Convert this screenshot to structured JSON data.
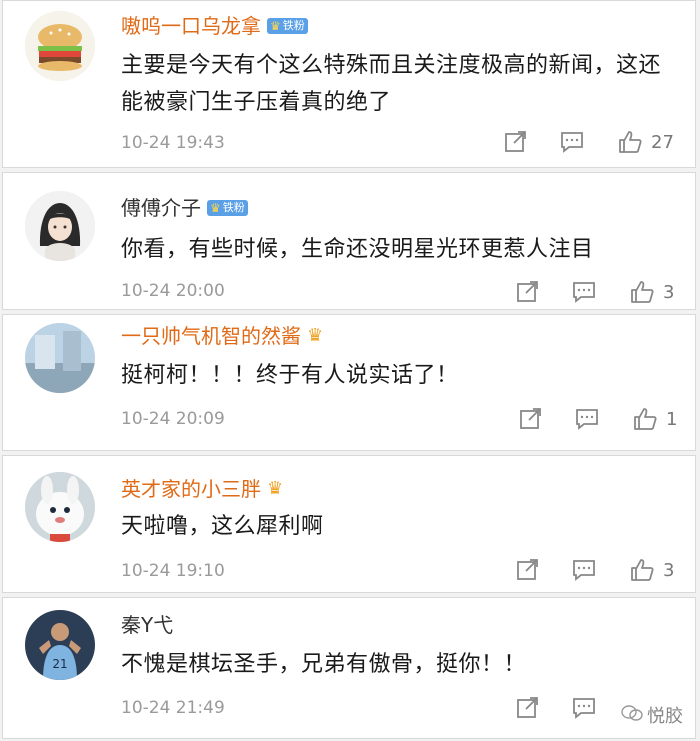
{
  "comments": [
    {
      "username": "嗷呜一口乌龙拿",
      "badge": "铁粉",
      "name_style": "vip",
      "text": "主要是今天有个这么特殊而且关注度极高的新闻，这还能被豪门生子压着真的绝了",
      "timestamp": "10-24 19:43",
      "likes": "27"
    },
    {
      "username": "傅傅介子",
      "badge": "铁粉",
      "name_style": "plain",
      "text": "你看，有些时候，生命还没明星光环更惹人注目",
      "timestamp": "10-24 20:00",
      "likes": "3"
    },
    {
      "username": "一只帅气机智的然酱",
      "badge": "",
      "name_style": "vip",
      "text": "挺柯柯！！！终于有人说实话了！",
      "timestamp": "10-24 20:09",
      "likes": "1"
    },
    {
      "username": "英才家的小三胖",
      "badge": "",
      "name_style": "vip",
      "text": "天啦噜，这么犀利啊",
      "timestamp": "10-24 19:10",
      "likes": "3"
    },
    {
      "username": "秦Y弋",
      "badge": "",
      "name_style": "plain",
      "text": "不愧是棋坛圣手，兄弟有傲骨，挺你！！",
      "timestamp": "10-24 21:49",
      "likes": ""
    }
  ],
  "watermark": "悦胶",
  "icons": {
    "share": "share-icon",
    "comment": "comment-icon",
    "like": "thumbs-up-icon",
    "crown": "crown-icon"
  },
  "colors": {
    "vip_name": "#e06a16",
    "meta": "#9a9a9a",
    "badge_bg": "#5aa0e6"
  }
}
